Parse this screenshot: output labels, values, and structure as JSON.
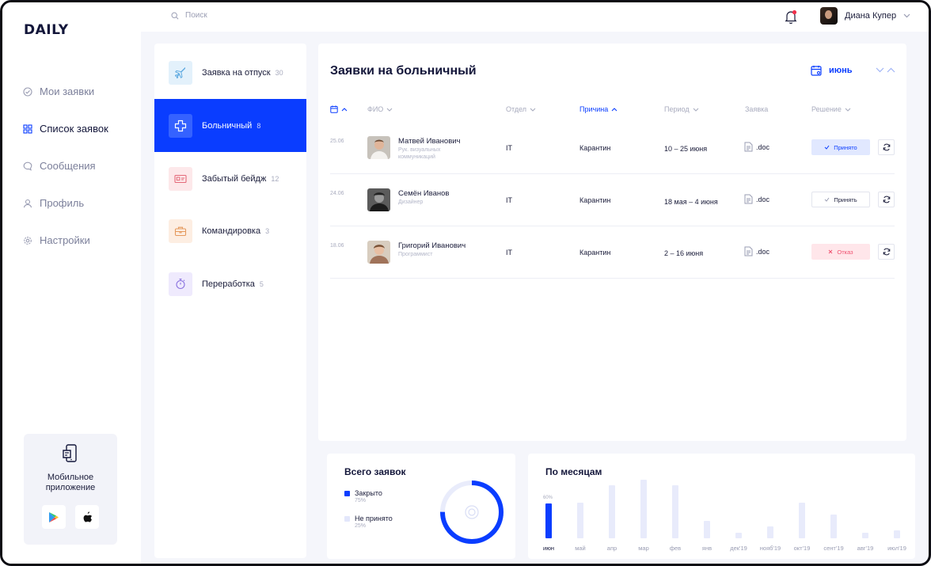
{
  "app": {
    "logo": "DAILY"
  },
  "nav": {
    "items": [
      {
        "label": "Мои заявки",
        "icon": "check-circle-icon",
        "active": false
      },
      {
        "label": "Список заявок",
        "icon": "grid-icon",
        "active": true
      },
      {
        "label": "Сообщения",
        "icon": "chat-icon",
        "active": false
      },
      {
        "label": "Профиль",
        "icon": "user-icon",
        "active": false
      },
      {
        "label": "Настройки",
        "icon": "gear-icon",
        "active": false
      }
    ],
    "mobile": {
      "title": "Мобильное приложение",
      "stores": [
        "google-play-icon",
        "apple-icon"
      ]
    }
  },
  "topbar": {
    "search_placeholder": "Поиск",
    "user_name": "Диана Купер",
    "notification_dot_color": "#f0314c"
  },
  "categories": [
    {
      "label": "Заявка на отпуск",
      "count": "30",
      "icon": "plane-icon",
      "tint": "#e3f1fb",
      "stroke": "#5da9e0"
    },
    {
      "label": "Больничный",
      "count": "8",
      "icon": "medical-cross-icon",
      "tint": "#3562ff",
      "stroke": "#ffffff",
      "active": true
    },
    {
      "label": "Забытый бейдж",
      "count": "12",
      "icon": "badge-icon",
      "tint": "#fde8ea",
      "stroke": "#e46a7a"
    },
    {
      "label": "Командировка",
      "count": "3",
      "icon": "briefcase-icon",
      "tint": "#fdeee2",
      "stroke": "#e59a5e"
    },
    {
      "label": "Переработка",
      "count": "5",
      "icon": "stopwatch-icon",
      "tint": "#efeafd",
      "stroke": "#8a72df"
    }
  ],
  "main": {
    "title": "Заявки на больничный",
    "month": "июнь",
    "columns": {
      "fio": "ФИО",
      "dept": "Отдел",
      "reason": "Причина",
      "period": "Период",
      "request": "Заявка",
      "decision": "Решение"
    },
    "rows": [
      {
        "date": "25.06",
        "name": "Матвей Иванович",
        "role": "Рук. визуальных коммуникаций",
        "dept": "IT",
        "reason": "Карантин",
        "period": "10 – 25 июня",
        "doc": ".doc",
        "decision": "Принято",
        "decision_state": "accepted"
      },
      {
        "date": "24.06",
        "name": "Семён Иванов",
        "role": "Дизайнер",
        "dept": "IT",
        "reason": "Карантин",
        "period": "18 мая – 4 июня",
        "doc": ".doc",
        "decision": "Принять",
        "decision_state": "pending"
      },
      {
        "date": "18.06",
        "name": "Григорий Иванович",
        "role": "Программист",
        "dept": "IT",
        "reason": "Карантин",
        "period": "2 – 16 июня",
        "doc": ".doc",
        "decision": "Отказ",
        "decision_state": "rejected"
      }
    ]
  },
  "summary": {
    "title": "Всего заявок",
    "legend": [
      {
        "label": "Закрыто",
        "pct": "75%",
        "color": "#0a3dff"
      },
      {
        "label": "Не принято",
        "pct": "25%",
        "color": "#e3e7fb"
      }
    ]
  },
  "chart_data": {
    "type": "bar",
    "title": "По месяцам",
    "categories": [
      "июн",
      "май",
      "апр",
      "мар",
      "фев",
      "янв",
      "дек'19",
      "нояб'19",
      "окт'19",
      "сент'19",
      "авг'19",
      "июл'19"
    ],
    "values": [
      60,
      61,
      91,
      100,
      91,
      30,
      10,
      20,
      61,
      41,
      10,
      13
    ],
    "value_label_first": "60%",
    "ylim": [
      0,
      100
    ],
    "highlight": "июн",
    "colors": {
      "active": "#0a3dff",
      "inactive": "#e8ebfb"
    }
  }
}
